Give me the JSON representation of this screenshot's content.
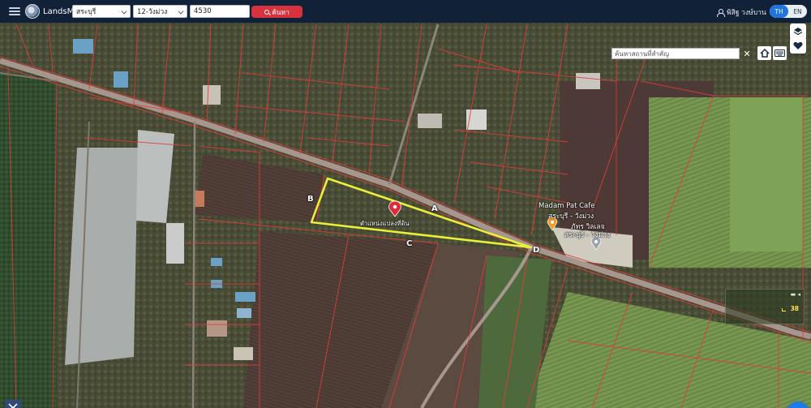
{
  "app": {
    "brand": "LandsMaps"
  },
  "search": {
    "province": "สระบุรี",
    "district": "12-วังม่วง",
    "parcel_number": "4530",
    "button_label": "ค้นหา"
  },
  "user": {
    "name": "พิสิฐ วงษ์บาน"
  },
  "language": {
    "th": "TH",
    "en": "EN",
    "selected": "TH"
  },
  "map": {
    "place_search_placeholder": "ค้นหาสถานที่สำคัญ",
    "parcel_label": "ตำแหน่งแปลงที่ดิน",
    "side_labels": {
      "a": "A",
      "b": "B",
      "c": "C",
      "d": "D"
    },
    "pois": [
      {
        "name": "Madam Pat Cafe",
        "sub": "สระบุรี - วังม่วง",
        "icon": "cafe-pin-icon",
        "color": "#f39a2b"
      },
      {
        "name": "ภัทร วิลเลจ",
        "sub": "สระบุรี - วังม่วง",
        "icon": "location-pin-icon",
        "color": "#9aa3ad"
      }
    ],
    "info_value": "38",
    "boundary_color": "#e33b3b",
    "parcel_color": "#e8f03a",
    "marker_color": "#e02a3a"
  }
}
